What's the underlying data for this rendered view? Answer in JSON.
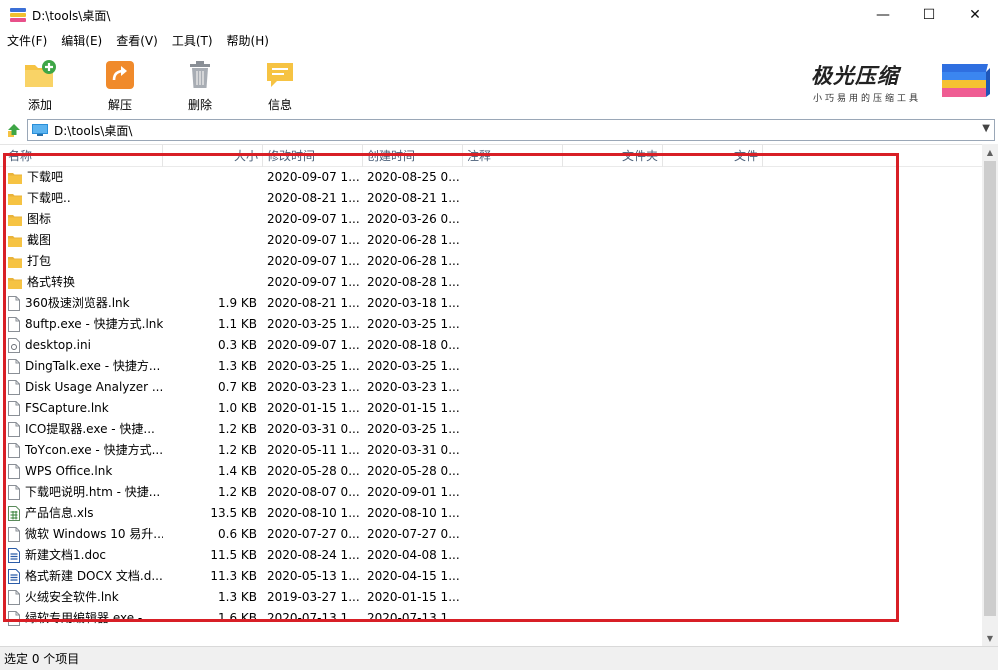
{
  "window": {
    "title": "D:\\tools\\桌面\\",
    "minimize_glyph": "—",
    "maximize_glyph": "☐",
    "close_glyph": "✕"
  },
  "menu": [
    "文件(F)",
    "编辑(E)",
    "查看(V)",
    "工具(T)",
    "帮助(H)"
  ],
  "toolbar": {
    "add": "添加",
    "extract": "解压",
    "delete": "删除",
    "info": "信息"
  },
  "brand": {
    "title": "极光压缩",
    "subtitle": "小巧易用的压缩工具"
  },
  "address": {
    "path": "D:\\tools\\桌面\\"
  },
  "columns": {
    "name": "名称",
    "size": "大小",
    "modified": "修改时间",
    "created": "创建时间",
    "comment": "注释",
    "folders": "文件夹",
    "files": "文件"
  },
  "files": [
    {
      "name": "下载吧",
      "size": "",
      "modified": "2020-09-07 1...",
      "created": "2020-08-25 0...",
      "icon": "folder-icon"
    },
    {
      "name": "下载吧..",
      "size": "",
      "modified": "2020-08-21 1...",
      "created": "2020-08-21 1...",
      "icon": "folder-icon"
    },
    {
      "name": "图标",
      "size": "",
      "modified": "2020-09-07 1...",
      "created": "2020-03-26 0...",
      "icon": "folder-icon"
    },
    {
      "name": "截图",
      "size": "",
      "modified": "2020-09-07 1...",
      "created": "2020-06-28 1...",
      "icon": "folder-icon"
    },
    {
      "name": "打包",
      "size": "",
      "modified": "2020-09-07 1...",
      "created": "2020-06-28 1...",
      "icon": "folder-icon"
    },
    {
      "name": "格式转换",
      "size": "",
      "modified": "2020-09-07 1...",
      "created": "2020-08-28 1...",
      "icon": "folder-icon"
    },
    {
      "name": "360极速浏览器.lnk",
      "size": "1.9 KB",
      "modified": "2020-08-21 1...",
      "created": "2020-03-18 1...",
      "icon": "file-icon"
    },
    {
      "name": "8uftp.exe - 快捷方式.lnk",
      "size": "1.1 KB",
      "modified": "2020-03-25 1...",
      "created": "2020-03-25 1...",
      "icon": "file-icon"
    },
    {
      "name": "desktop.ini",
      "size": "0.3 KB",
      "modified": "2020-09-07 1...",
      "created": "2020-08-18 0...",
      "icon": "settings-file-icon"
    },
    {
      "name": "DingTalk.exe - 快捷方...",
      "size": "1.3 KB",
      "modified": "2020-03-25 1...",
      "created": "2020-03-25 1...",
      "icon": "file-icon"
    },
    {
      "name": "Disk Usage Analyzer ...",
      "size": "0.7 KB",
      "modified": "2020-03-23 1...",
      "created": "2020-03-23 1...",
      "icon": "file-icon"
    },
    {
      "name": "FSCapture.lnk",
      "size": "1.0 KB",
      "modified": "2020-01-15 1...",
      "created": "2020-01-15 1...",
      "icon": "file-icon"
    },
    {
      "name": "ICO提取器.exe - 快捷...",
      "size": "1.2 KB",
      "modified": "2020-03-31 0...",
      "created": "2020-03-25 1...",
      "icon": "file-icon"
    },
    {
      "name": "ToYcon.exe - 快捷方式...",
      "size": "1.2 KB",
      "modified": "2020-05-11 1...",
      "created": "2020-03-31 0...",
      "icon": "file-icon"
    },
    {
      "name": "WPS Office.lnk",
      "size": "1.4 KB",
      "modified": "2020-05-28 0...",
      "created": "2020-05-28 0...",
      "icon": "file-icon"
    },
    {
      "name": "下载吧说明.htm - 快捷...",
      "size": "1.2 KB",
      "modified": "2020-08-07 0...",
      "created": "2020-09-01 1...",
      "icon": "file-icon"
    },
    {
      "name": "产品信息.xls",
      "size": "13.5 KB",
      "modified": "2020-08-10 1...",
      "created": "2020-08-10 1...",
      "icon": "spreadsheet-icon"
    },
    {
      "name": "微软 Windows 10 易升...",
      "size": "0.6 KB",
      "modified": "2020-07-27 0...",
      "created": "2020-07-27 0...",
      "icon": "file-icon"
    },
    {
      "name": "新建文档1.doc",
      "size": "11.5 KB",
      "modified": "2020-08-24 1...",
      "created": "2020-04-08 1...",
      "icon": "document-icon"
    },
    {
      "name": "格式新建 DOCX 文档.d...",
      "size": "11.3 KB",
      "modified": "2020-05-13 1...",
      "created": "2020-04-15 1...",
      "icon": "document-icon"
    },
    {
      "name": "火绒安全软件.lnk",
      "size": "1.3 KB",
      "modified": "2019-03-27 1...",
      "created": "2020-01-15 1...",
      "icon": "file-icon"
    },
    {
      "name": "绿软专用编辑器.exe - ...",
      "size": "1.6 KB",
      "modified": "2020-07-13 1...",
      "created": "2020-07-13 1...",
      "icon": "file-icon"
    }
  ],
  "status": {
    "text": "选定 0 个项目"
  },
  "colors": {
    "highlight": "#d81f26",
    "folder": "#f6c343",
    "header_text": "#4c607a"
  }
}
